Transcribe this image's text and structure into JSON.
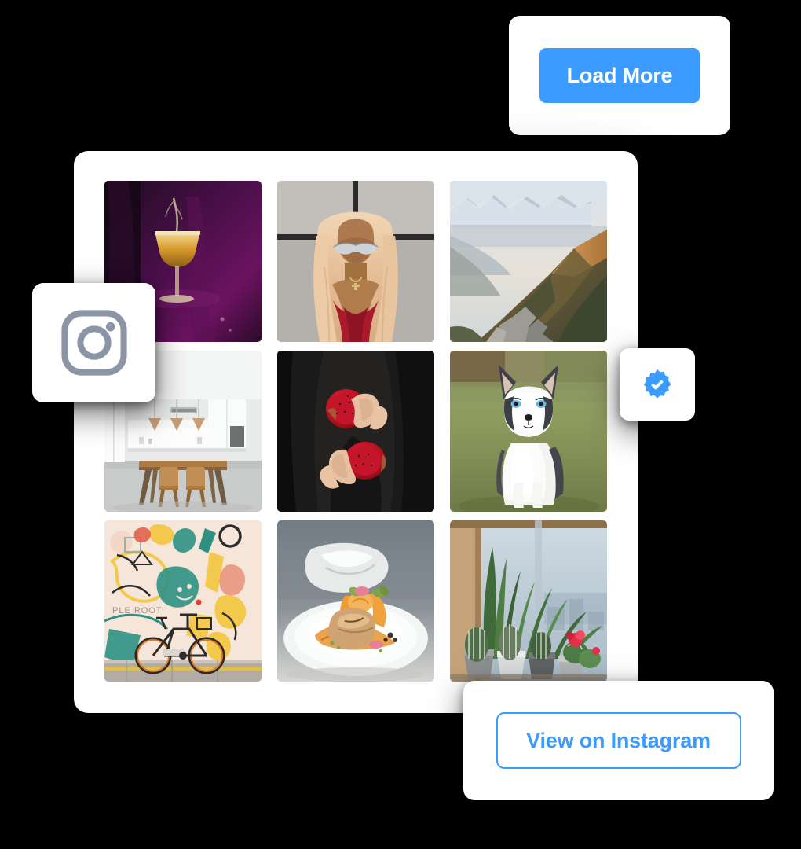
{
  "colors": {
    "accent": "#3b9bff",
    "card_background": "#ffffff",
    "page_background": "#000000",
    "instagram_logo": "#8b95a5",
    "verified_badge": "#3b9bff"
  },
  "load_more_card": {
    "button_label": "Load More",
    "icon": "none"
  },
  "instagram_logo_card": {
    "icon": "instagram-icon",
    "label": "Instagram"
  },
  "verified_card": {
    "icon": "verified-badge-icon",
    "label": "Verified"
  },
  "view_card": {
    "button_label": "View on Instagram"
  },
  "gallery": {
    "columns": 3,
    "rows": 3,
    "tiles": [
      {
        "id": "tile-1",
        "alt": "Golden cocktail coupe glass on purple velvet",
        "theme": "cocktail"
      },
      {
        "id": "tile-2",
        "alt": "Woman with long blonde wavy hair and sunglasses against gray wall",
        "theme": "portrait"
      },
      {
        "id": "tile-3",
        "alt": "Mountain ridge at sunrise above a lake valley",
        "theme": "mountains"
      },
      {
        "id": "tile-4",
        "alt": "Bright white minimalist kitchen with wooden dining table",
        "theme": "kitchen"
      },
      {
        "id": "tile-5",
        "alt": "Hands in black sweater holding halves of a red dragon fruit",
        "theme": "dragonfruit"
      },
      {
        "id": "tile-6",
        "alt": "Husky puppy sitting on grass looking up",
        "theme": "husky"
      },
      {
        "id": "tile-7",
        "alt": "Bicycle leaning against a colorful abstract mural wall",
        "theme": "mural"
      },
      {
        "id": "tile-8",
        "alt": "Plated gourmet dish with orange sauce and herbs",
        "theme": "food"
      },
      {
        "id": "tile-9",
        "alt": "Cacti and succulents in pots on a sunny windowsill",
        "theme": "cacti"
      }
    ]
  }
}
